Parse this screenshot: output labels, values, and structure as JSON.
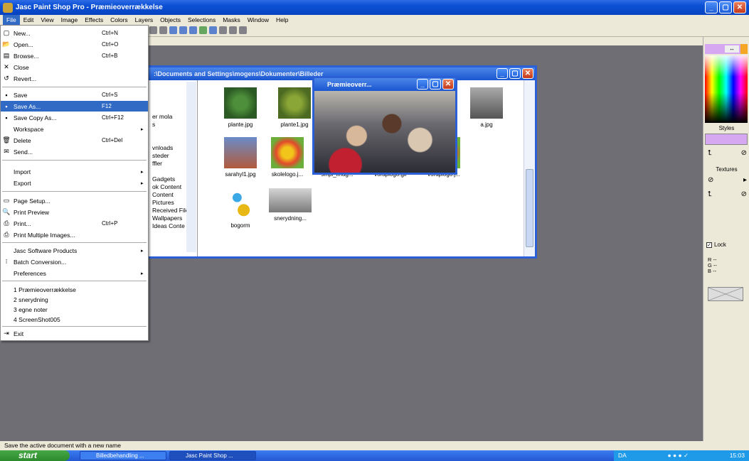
{
  "app": {
    "title": "Jasc Paint Shop Pro - Præmieoverrækkelse",
    "win_min": "_",
    "win_max": "▢",
    "win_close": "✕"
  },
  "menubar": [
    "File",
    "Edit",
    "View",
    "Image",
    "Effects",
    "Colors",
    "Layers",
    "Objects",
    "Selections",
    "Masks",
    "Window",
    "Help"
  ],
  "file_menu": {
    "items": [
      {
        "label": "New...",
        "shortcut": "Ctrl+N"
      },
      {
        "label": "Open...",
        "shortcut": "Ctrl+O"
      },
      {
        "label": "Browse...",
        "shortcut": "Ctrl+B"
      },
      {
        "label": "Close",
        "shortcut": ""
      },
      {
        "label": "Revert...",
        "shortcut": ""
      },
      {
        "label": "Save",
        "shortcut": "Ctrl+S"
      },
      {
        "label": "Save As...",
        "shortcut": "F12"
      },
      {
        "label": "Save Copy As...",
        "shortcut": "Ctrl+F12"
      },
      {
        "label": "Workspace",
        "shortcut": ""
      },
      {
        "label": "Delete",
        "shortcut": "Ctrl+Del"
      },
      {
        "label": "Send...",
        "shortcut": ""
      },
      {
        "label": "Import",
        "shortcut": ""
      },
      {
        "label": "Export",
        "shortcut": ""
      },
      {
        "label": "Page Setup...",
        "shortcut": ""
      },
      {
        "label": "Print Preview",
        "shortcut": ""
      },
      {
        "label": "Print...",
        "shortcut": "Ctrl+P"
      },
      {
        "label": "Print Multiple Images...",
        "shortcut": ""
      },
      {
        "label": "Jasc Software Products",
        "shortcut": ""
      },
      {
        "label": "Batch Conversion...",
        "shortcut": ""
      },
      {
        "label": "Preferences",
        "shortcut": ""
      },
      {
        "label": "1 Præmieoverrækkelse",
        "shortcut": ""
      },
      {
        "label": "2 snerydning",
        "shortcut": ""
      },
      {
        "label": "3 egne noter",
        "shortcut": ""
      },
      {
        "label": "4 ScreenShot005",
        "shortcut": ""
      },
      {
        "label": "Exit",
        "shortcut": ""
      }
    ]
  },
  "browser": {
    "title": ":\\Documents and Settings\\mogens\\Dokumenter\\Billeder",
    "tree": [
      "er mola",
      "s",
      "",
      "",
      "vnloads",
      "steder",
      "ffler",
      "",
      "Gadgets",
      "ok Content",
      "Content",
      "Pictures",
      "Received File",
      "Wallpapers",
      "Ideas Conte"
    ],
    "thumbnails": [
      {
        "name": "plante.jpg"
      },
      {
        "name": "plante1.jpg"
      },
      {
        "name": "a.jpg"
      },
      {
        "name": "sarahyl1.jpg"
      },
      {
        "name": "skolelogo.j..."
      },
      {
        "name": "smpl_imag..."
      },
      {
        "name": "voraplogo.gif"
      },
      {
        "name": "voraplogo.j..."
      },
      {
        "name": "bogorm"
      },
      {
        "name": "snerydning..."
      }
    ]
  },
  "photo_window": {
    "title": "Præmieoverr..."
  },
  "palette": {
    "swap": "↔",
    "styles": "Styles",
    "textures": "Textures",
    "lock": "Lock",
    "lock_check": "✓",
    "r": "R  --",
    "g": "G  --",
    "b": "B  --"
  },
  "status": {
    "text": "Save the active document with a new name"
  },
  "taskbar": {
    "start": "start",
    "tasks": [
      "Billedbehandling ...",
      "Jasc Paint Shop ..."
    ],
    "lang": "DA",
    "clock": "15:03"
  }
}
